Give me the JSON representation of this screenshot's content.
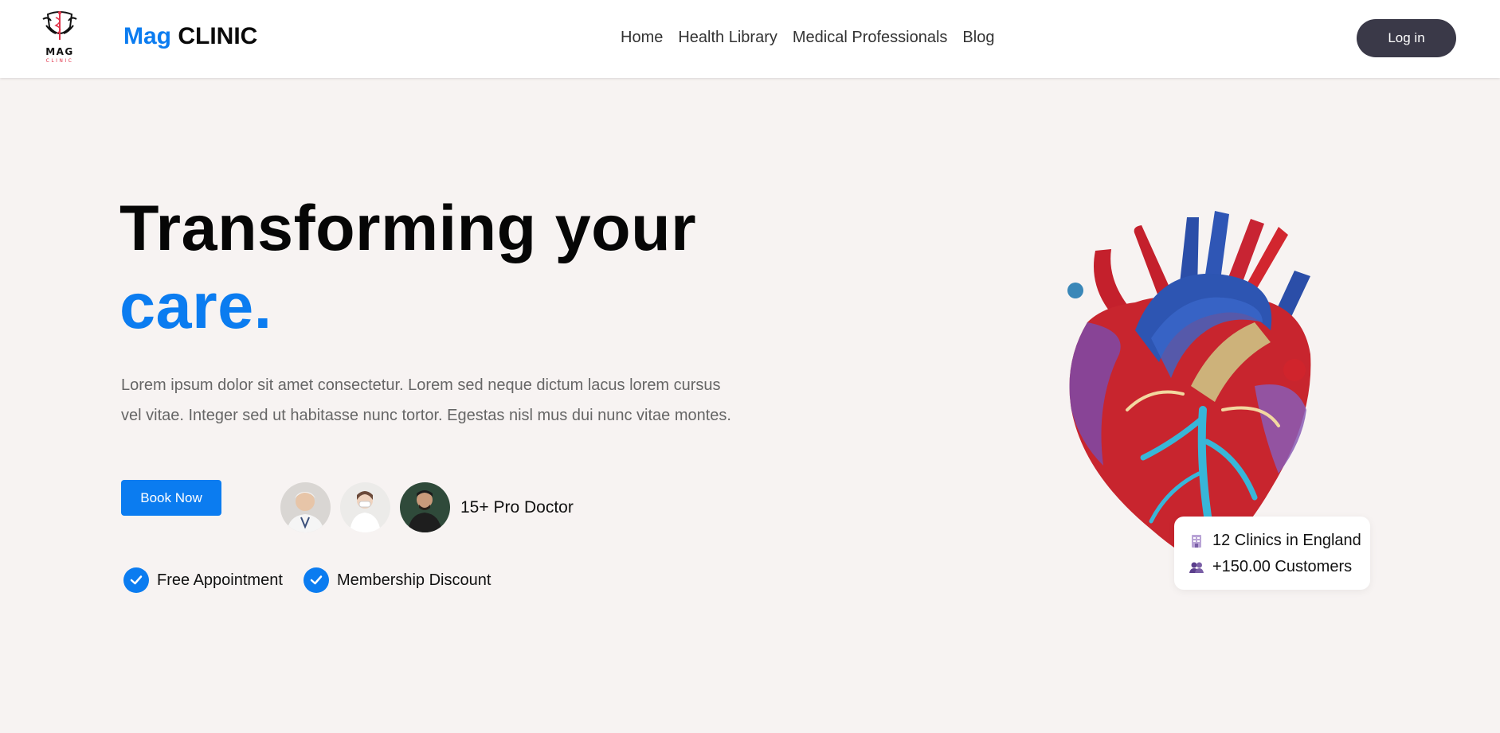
{
  "header": {
    "logo": {
      "word": "MAG",
      "sub": "CLINIC"
    },
    "brand": {
      "part1": "Mag",
      "part2": "CLINIC"
    },
    "nav": [
      {
        "label": "Home"
      },
      {
        "label": "Health Library"
      },
      {
        "label": "Medical Professionals"
      },
      {
        "label": "Blog"
      }
    ],
    "login_label": "Log in"
  },
  "hero": {
    "headline_line1": "Transforming your",
    "headline_line2": "care.",
    "description": "Lorem ipsum dolor sit amet consectetur. Lorem sed neque dictum lacus lorem cursus vel vitae. Integer sed ut habitasse nunc tortor. Egestas nisl mus dui nunc vitae montes.",
    "book_label": "Book Now",
    "doctors_label": "15+ Pro Doctor",
    "features": [
      {
        "label": "Free Appointment"
      },
      {
        "label": "Membership Discount"
      }
    ]
  },
  "stats": [
    {
      "icon": "building-icon",
      "label": "12 Clinics in England"
    },
    {
      "icon": "users-icon",
      "label": "+150.00 Customers"
    }
  ],
  "colors": {
    "accent": "#0b7cf0",
    "login_bg": "#3a3948",
    "page_bg": "#f7f3f2",
    "logo_accent": "#e0344a"
  }
}
